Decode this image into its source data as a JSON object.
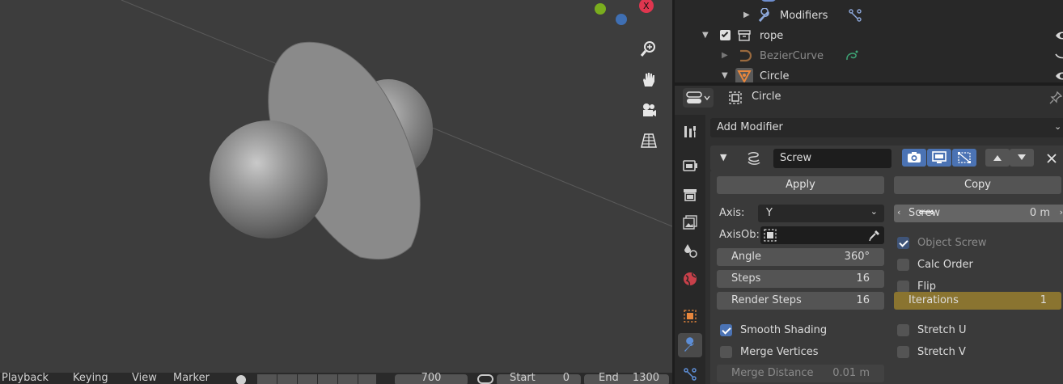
{
  "viewport": {
    "gizmo": {
      "x_axis_label": "X",
      "x_color": "#e0364f",
      "y_color": "#7aad1e",
      "z_color": "#3f6fb3"
    },
    "nav_buttons": [
      "zoom-icon",
      "hand-pan-icon",
      "camera-icon",
      "grid-perspective-icon"
    ]
  },
  "timeline": {
    "menus": [
      "Playback",
      "Keying",
      "View",
      "Marker"
    ],
    "current_frame": "700",
    "start_label": "Start",
    "start_value": "0",
    "end_label": "End",
    "end_value": "1300"
  },
  "outliner": {
    "rows": [
      {
        "label": "Modifiers",
        "icon": "wrench-icon"
      },
      {
        "label": "rope",
        "icon": "collection-icon"
      },
      {
        "label": "BezierCurve",
        "icon": "curve-icon"
      },
      {
        "label": "Circle",
        "icon": "mesh-icon"
      }
    ]
  },
  "properties": {
    "object_name": "Circle",
    "add_modifier": "Add Modifier",
    "modifier": {
      "name": "Screw",
      "apply": "Apply",
      "copy": "Copy",
      "axis_label": "Axis:",
      "axis_value": "Y",
      "axis_ob_label": "AxisOb:",
      "angle_label": "Angle",
      "angle_value": "360°",
      "steps_label": "Steps",
      "steps_value": "16",
      "render_steps_label": "Render Steps",
      "render_steps_value": "16",
      "smooth_shading": "Smooth Shading",
      "smooth_shading_checked": true,
      "merge_vertices": "Merge Vertices",
      "merge_vertices_checked": false,
      "merge_distance_label": "Merge Distance",
      "merge_distance_value": "0.01 m",
      "screw_label": "Screw",
      "screw_value": "0 m",
      "object_screw": "Object Screw",
      "calc_order": "Calc Order",
      "flip": "Flip",
      "iterations_label": "Iterations",
      "iterations_value": "1",
      "stretch_u": "Stretch U",
      "stretch_v": "Stretch V"
    },
    "colors": {
      "accent_blue": "#4b73b4",
      "iterations_gold": "#8a7430",
      "orange_active": "#e8873d"
    }
  }
}
